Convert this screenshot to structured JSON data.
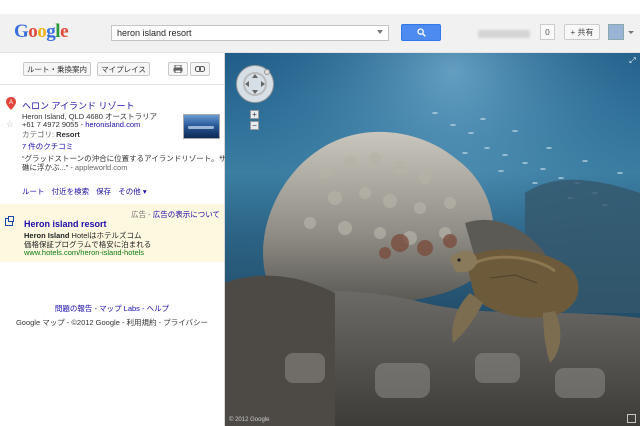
{
  "header": {
    "logo": [
      "G",
      "o",
      "o",
      "g",
      "l",
      "e"
    ],
    "logo_colors": [
      "#3a6fe0",
      "#e04a3a",
      "#f2b21b",
      "#3a6fe0",
      "#2a9a3a",
      "#e04a3a"
    ],
    "search_value": "heron island resort",
    "search_icon": "search-icon",
    "count": "0",
    "share_label": "+ 共有"
  },
  "panel": {
    "buttons": [
      "ルート・乗換案内",
      "マイプレイス"
    ],
    "tools": [
      "print-icon",
      "link-icon"
    ],
    "result": {
      "title": "ヘロン アイランド リゾート",
      "address": "Heron Island, QLD 4680 オーストラリア",
      "phone": "+61 7 4972 9055",
      "site": "heronisland.com",
      "category_label": "カテゴリ: ",
      "category_value": "Resort",
      "reviews": "7 件のクチコミ",
      "snippet1": "“グラッドストーンの沖合に位置するアイランドリゾート。サンゴ",
      "snippet2_main": "礁に浮かぶ...” - ",
      "snippet2_source": "appleworld.com",
      "actions": [
        "ルート",
        "付近を検索",
        "保存",
        "その他 ▾"
      ]
    },
    "ad": {
      "meta_label": "広告",
      "meta_link": "広告の表示について",
      "title": "Heron island resort",
      "line1_bold": "Heron Island",
      "line1_rest": " Hotelはホテルズコム",
      "line2": "価格保証プログラムで格安に泊まれる",
      "url": "www.hotels.com/heron-island-hotels"
    },
    "footer_links": "問題の報告 - マップ Labs - ヘルプ",
    "footer_text": "Google マップ - ©2012 Google - 利用規約 - プライバシー"
  },
  "streetview": {
    "copyright": "© 2012 Google"
  }
}
